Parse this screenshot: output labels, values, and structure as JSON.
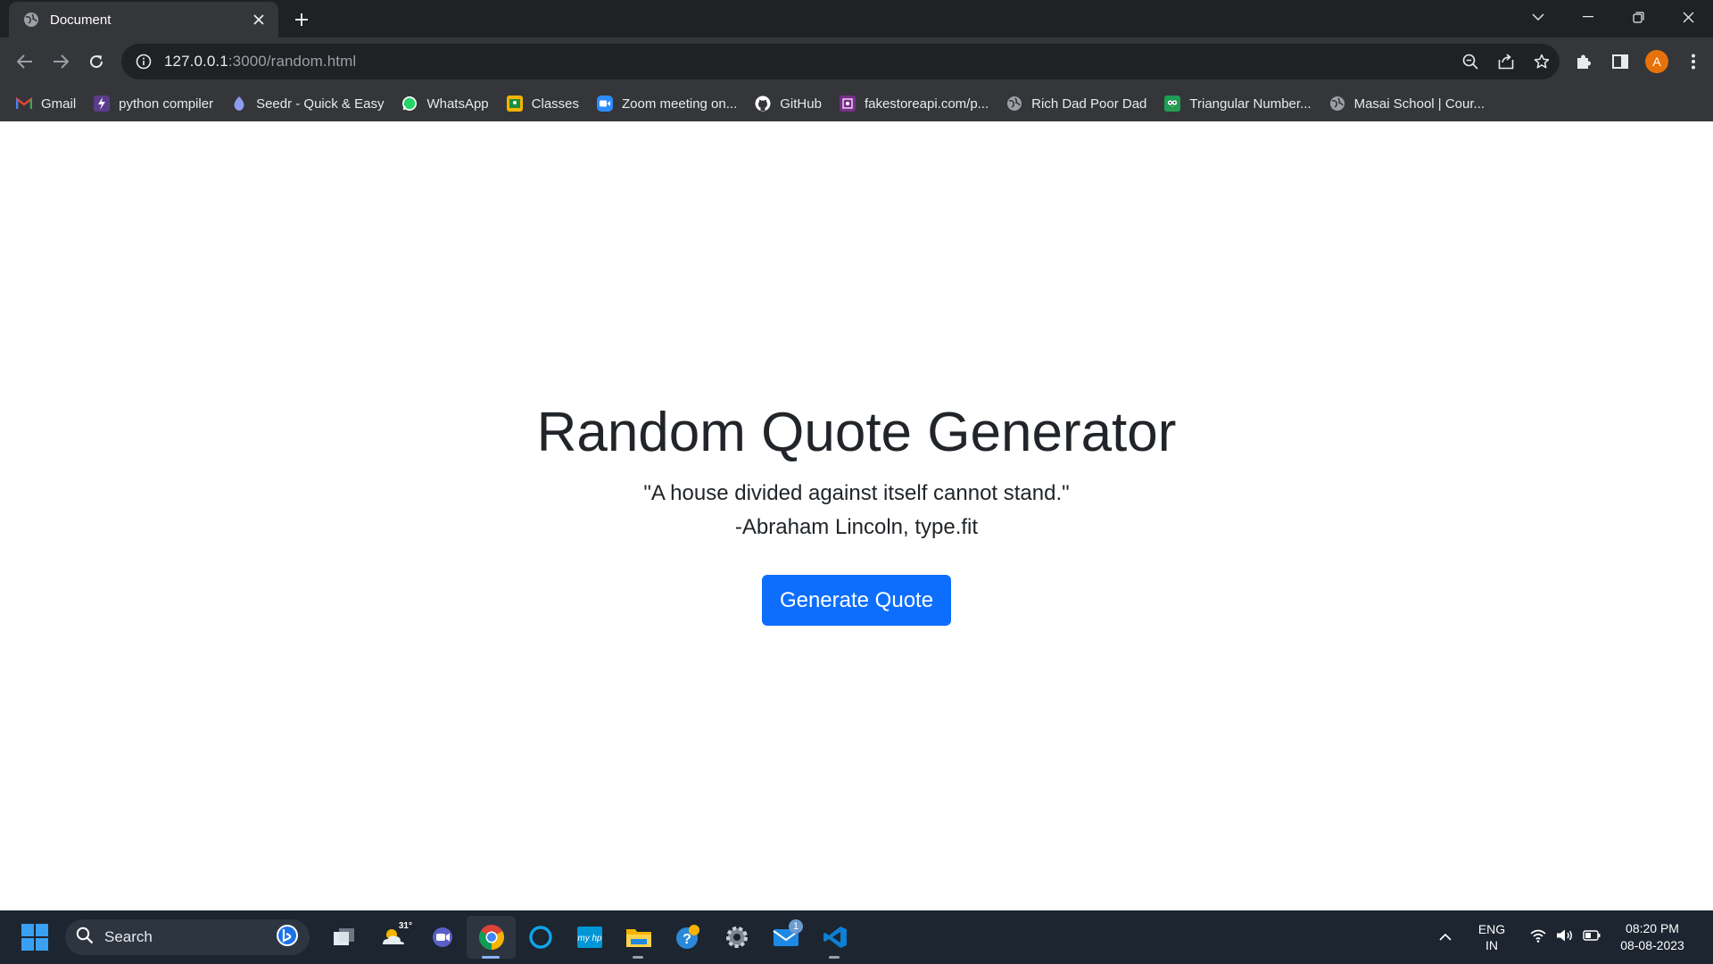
{
  "browser": {
    "tab_title": "Document",
    "url_host": "127.0.0.1",
    "url_path": ":3000/random.html",
    "profile_initial": "A",
    "colors": {
      "tab_bg": "#35363a",
      "frame_bg": "#202124",
      "avatar": "#e8710a"
    }
  },
  "bookmarks": [
    {
      "label": "Gmail",
      "icon": "gmail-icon"
    },
    {
      "label": "python compiler",
      "icon": "bolt-icon"
    },
    {
      "label": "Seedr - Quick & Easy",
      "icon": "seedr-icon"
    },
    {
      "label": "WhatsApp",
      "icon": "whatsapp-icon"
    },
    {
      "label": "Classes",
      "icon": "classroom-icon"
    },
    {
      "label": "Zoom meeting on...",
      "icon": "zoom-icon"
    },
    {
      "label": "GitHub",
      "icon": "github-icon"
    },
    {
      "label": "fakestoreapi.com/p...",
      "icon": "fakestore-icon"
    },
    {
      "label": "Rich Dad Poor Dad",
      "icon": "globe-icon"
    },
    {
      "label": "Triangular Number...",
      "icon": "owl-icon"
    },
    {
      "label": "Masai School | Cour...",
      "icon": "globe-icon"
    }
  ],
  "page": {
    "heading": "Random Quote Generator",
    "quote": "\"A house divided against itself cannot stand.\"",
    "author": "-Abraham Lincoln, type.fit",
    "button_label": "Generate Quote",
    "button_color": "#0d6efd"
  },
  "taskbar": {
    "search_label": "Search",
    "weather_temp": "31°",
    "mail_badge": "1",
    "lang_line1": "ENG",
    "lang_line2": "IN",
    "time": "08:20 PM",
    "date": "08-08-2023"
  }
}
